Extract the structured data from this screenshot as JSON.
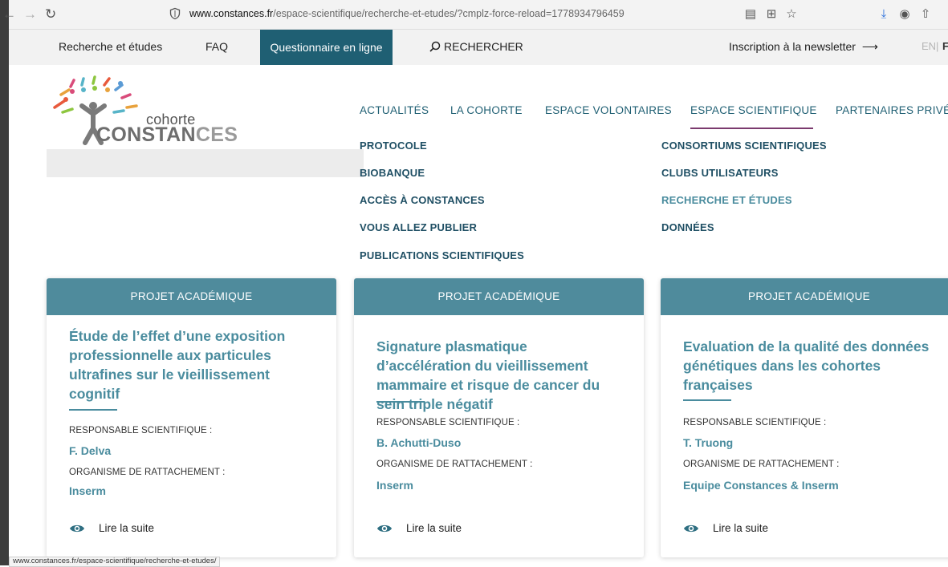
{
  "browser": {
    "url_domain": "www.constances.fr",
    "url_path": "/espace-scientifique/recherche-et-etudes/?cmplz-force-reload=1778934796459"
  },
  "topbar": {
    "recherche_etudes": "Recherche et études",
    "faq": "FAQ",
    "questionnaire": "Questionnaire en ligne",
    "rechercher": "RECHERCHER",
    "newsletter": "Inscription à la newsletter",
    "lang_en": "EN",
    "lang_sep": "|",
    "lang_fr": "FR"
  },
  "logo": {
    "cohorte": "cohorte",
    "constances_a": "CONSTAN",
    "constances_b": "CES"
  },
  "mainnav": {
    "actualites": "ACTUALITÉS",
    "cohorte": "LA COHORTE",
    "volontaires": "ESPACE VOLONTAIRES",
    "scientifique": "ESPACE SCIENTIFIQUE",
    "partenaires": "PARTENAIRES PRIVÉS"
  },
  "submenu": {
    "left": [
      "PROTOCOLE",
      "BIOBANQUE",
      "ACCÈS À CONSTANCES",
      "VOUS ALLEZ PUBLIER",
      "PUBLICATIONS SCIENTIFIQUES"
    ],
    "right": [
      "CONSORTIUMS SCIENTIFIQUES",
      "CLUBS UTILISATEURS",
      "RECHERCHE ET ÉTUDES",
      "DONNÉES"
    ]
  },
  "cards": [
    {
      "category": "PROJET ACADÉMIQUE",
      "title": "Étude de l’effet d’une exposition professionnelle aux particules ultrafines sur le vieillissement cognitif",
      "resp_label": "RESPONSABLE SCIENTIFIQUE :",
      "resp_value": "F. Delva",
      "org_label": "ORGANISME DE RATTACHEMENT :",
      "org_value": "Inserm",
      "more": "Lire la suite"
    },
    {
      "category": "PROJET ACADÉMIQUE",
      "title": "Signature plasmatique d’accélération du vieillissement mammaire et risque de cancer du sein triple négatif",
      "resp_label": "RESPONSABLE SCIENTIFIQUE :",
      "resp_value": "B. Achutti-Duso",
      "org_label": "ORGANISME DE RATTACHEMENT :",
      "org_value": "Inserm",
      "more": "Lire la suite"
    },
    {
      "category": "PROJET ACADÉMIQUE",
      "title": "Evaluation de la qualité des données génétiques dans les cohortes françaises",
      "resp_label": "RESPONSABLE SCIENTIFIQUE :",
      "resp_value": "T. Truong",
      "org_label": "ORGANISME DE RATTACHEMENT :",
      "org_value": "Equipe Constances & Inserm",
      "more": "Lire la suite"
    }
  ],
  "status_url": "www.constances.fr/espace-scientifique/recherche-et-etudes/"
}
